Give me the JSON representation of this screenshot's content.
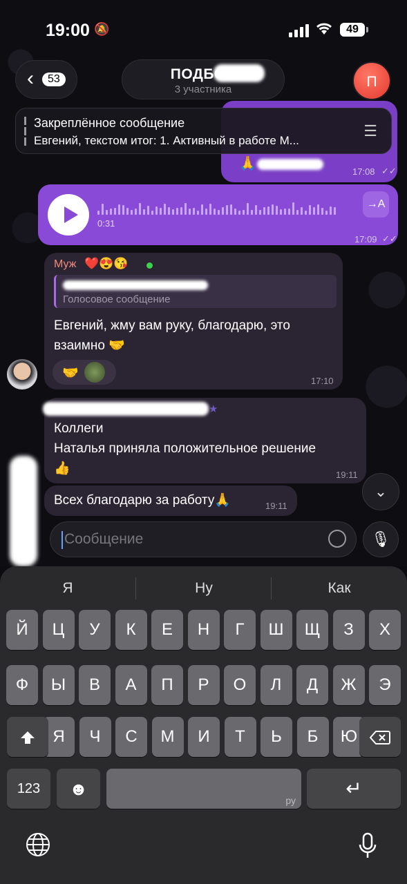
{
  "status_bar": {
    "time": "19:00",
    "battery": "49"
  },
  "header": {
    "unread_count": "53",
    "title": "ПОДБОР",
    "subtitle": "3 участника",
    "avatar_initial": "П"
  },
  "pinned": {
    "title": "Закреплённое сообщение",
    "text": "Евгений, текстом итог: 1. Активный в работе М..."
  },
  "messages": {
    "out_top_time": "17:08",
    "voice": {
      "duration": "0:31",
      "time": "17:09",
      "transcribe_label": "→A"
    },
    "m1": {
      "sender": "Муж",
      "sender_emoji": "❤️😍😘",
      "reply_text": "Голосовое сообщение",
      "line1": "Евгений, жму вам руку, благодарю, это",
      "line2": "взаимно 🤝",
      "reaction": "🤝",
      "time": "17:10"
    },
    "m2": {
      "line1": "Коллеги",
      "line2": "Наталья приняла положительное решение",
      "line3": "👍",
      "time": "19:11"
    },
    "m3": {
      "text": "Всех благодарю за работу🙏",
      "time": "19:11"
    }
  },
  "composer": {
    "placeholder": "Сообщение"
  },
  "keyboard": {
    "suggestions": [
      "Я",
      "Ну",
      "Как"
    ],
    "row1": [
      "Й",
      "Ц",
      "У",
      "К",
      "Е",
      "Н",
      "Г",
      "Ш",
      "Щ",
      "З",
      "Х"
    ],
    "row2": [
      "Ф",
      "Ы",
      "В",
      "А",
      "П",
      "Р",
      "О",
      "Л",
      "Д",
      "Ж",
      "Э"
    ],
    "row3": [
      "Я",
      "Ч",
      "С",
      "М",
      "И",
      "Т",
      "Ь",
      "Б",
      "Ю"
    ],
    "numbers_label": "123",
    "space_lang": "ру"
  },
  "colors": {
    "accent": "#8a4ad8",
    "incoming": "#2b2433",
    "keyboard": "#2a2a2d"
  }
}
